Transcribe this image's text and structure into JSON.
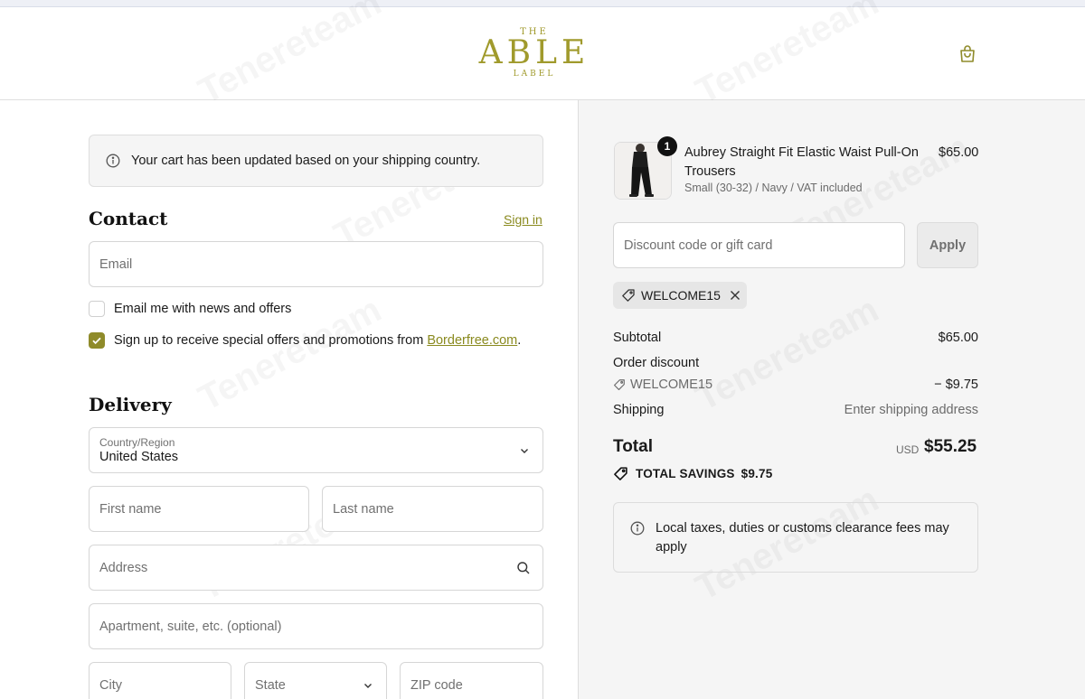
{
  "header": {
    "logo_top": "THE",
    "logo_main": "ABLE",
    "logo_bottom": "LABEL"
  },
  "notice": {
    "text": "Your cart has been updated based on your shipping country."
  },
  "contact": {
    "heading": "Contact",
    "signin_link": "Sign in",
    "email_placeholder": "Email",
    "news_label": "Email me with news and offers",
    "news_checked": false,
    "offers_label_prefix": "Sign up to receive special offers and promotions from ",
    "offers_link": "Borderfree.com",
    "offers_label_suffix": ".",
    "offers_checked": true
  },
  "delivery": {
    "heading": "Delivery",
    "country_label": "Country/Region",
    "country_value": "United States",
    "first_name_placeholder": "First name",
    "last_name_placeholder": "Last name",
    "address_placeholder": "Address",
    "apartment_placeholder": "Apartment, suite, etc. (optional)",
    "city_placeholder": "City",
    "state_placeholder": "State",
    "zip_placeholder": "ZIP code"
  },
  "summary": {
    "item": {
      "quantity": "1",
      "name": "Aubrey Straight Fit Elastic Waist Pull-On Trousers",
      "variant": "Small (30-32) / Navy / VAT included",
      "price": "$65.00"
    },
    "discount_placeholder": "Discount code or gift card",
    "apply_label": "Apply",
    "applied_code": "WELCOME15",
    "subtotal_label": "Subtotal",
    "subtotal_value": "$65.00",
    "order_discount_label": "Order discount",
    "discount_code_label": "WELCOME15",
    "discount_value": "− $9.75",
    "shipping_label": "Shipping",
    "shipping_value": "Enter shipping address",
    "total_label": "Total",
    "currency": "USD",
    "total_value": "$55.25",
    "savings_label": "TOTAL SAVINGS",
    "savings_value": "$9.75",
    "tax_notice": "Local taxes, duties or customs clearance fees may apply"
  },
  "colors": {
    "brand": "#a09a2c",
    "link": "#8a8a1f",
    "checkbox": "#8f8b2a"
  },
  "icons": {
    "cart": "shopping-bag-icon",
    "info": "info-icon",
    "chevron": "chevron-down-icon",
    "search": "search-icon",
    "tag": "tag-icon",
    "close": "close-icon",
    "check": "check-icon"
  }
}
